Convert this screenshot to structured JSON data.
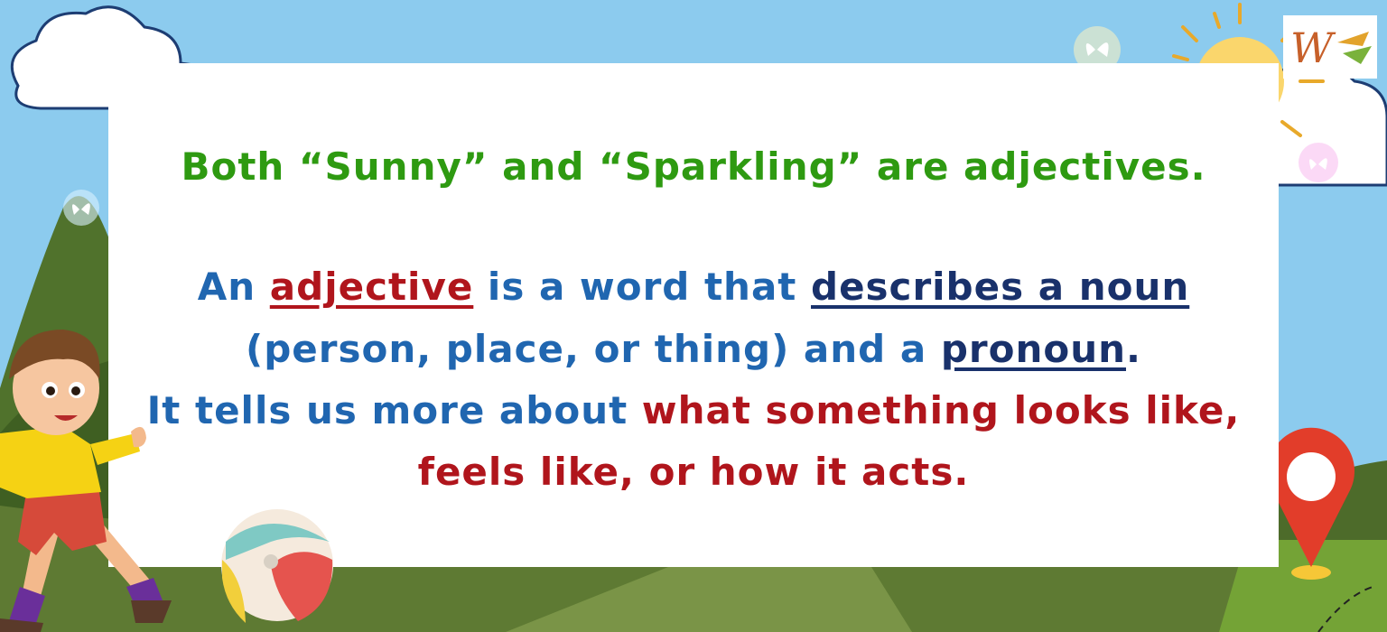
{
  "heading": {
    "text": "Both “Sunny” and “Sparkling” are adjectives."
  },
  "definition": {
    "line1": {
      "before": "An ",
      "keyword": "adjective",
      "middle": " is a word that ",
      "phrase": "describes a noun"
    },
    "line2": {
      "before": "(person, place, or thing) and a ",
      "keyword": "pronoun",
      "after": "."
    },
    "line3": {
      "before": "It tells us more about ",
      "highlight": "what something looks like,"
    },
    "line4": {
      "highlight": "feels like, or how it acts."
    }
  },
  "colors": {
    "heading": "#2e9a11",
    "body": "#2066b0",
    "highlight": "#b0151c",
    "keyword_navy": "#19316b",
    "sky": "#8ccbee",
    "grass": "#5e7a33"
  },
  "illustrations": {
    "boy": "boy-kicking-icon",
    "ball": "beach-ball-icon",
    "sun": "sun-icon",
    "pin": "location-pin-icon",
    "butterfly": "butterfly-icon",
    "logo": "logo-w-icon"
  }
}
